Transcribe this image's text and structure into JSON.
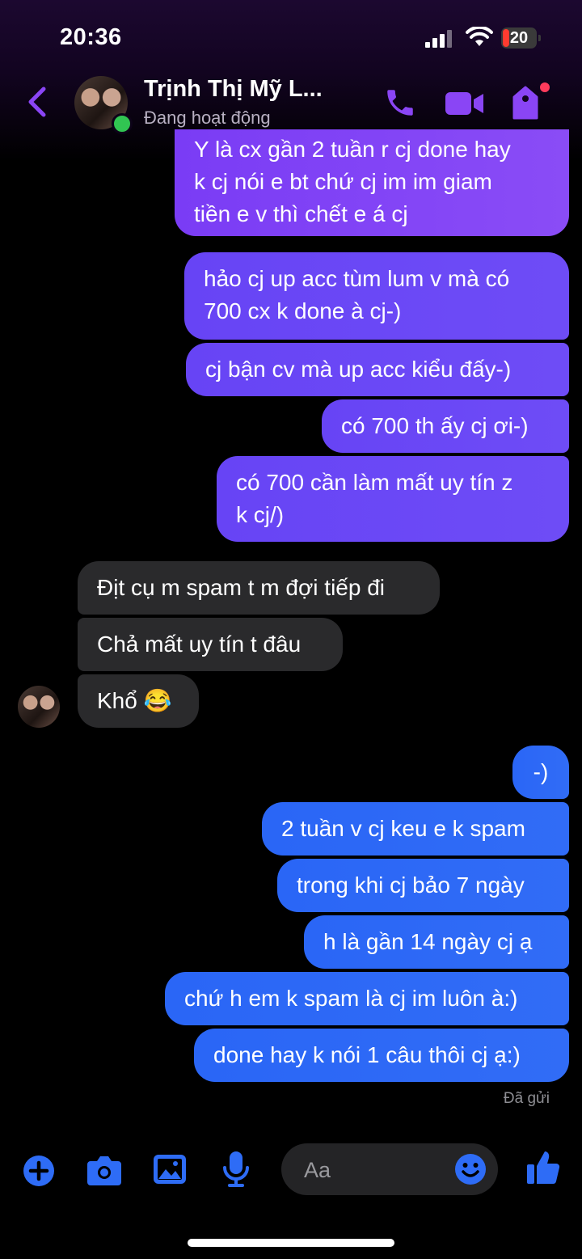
{
  "status_bar": {
    "time": "20:36",
    "battery": "20",
    "battery_level": 0.2
  },
  "header": {
    "contact_name": "Trịnh Thị Mỹ L...",
    "status": "Đang hoạt động",
    "icons": [
      "back-icon",
      "phone-icon",
      "video-icon",
      "tag-icon"
    ]
  },
  "messages": [
    {
      "side": "out",
      "lines": [
        "Y là cx gần 2 tuần r cj done hay",
        "k cj nói e bt chứ cj im im giam",
        "tiền e v thì chết e á cj"
      ]
    },
    {
      "side": "out",
      "lines": [
        "hảo cj up acc tùm lum v mà có",
        "700 cx k done à cj-)"
      ]
    },
    {
      "side": "out",
      "lines": [
        "cj bận cv mà up acc kiểu đấy-)"
      ]
    },
    {
      "side": "out",
      "lines": [
        "có 700 th ấy cj ơi-)"
      ]
    },
    {
      "side": "out",
      "lines": [
        "có 700 cần làm mất uy tín z",
        "k cj/)"
      ]
    },
    {
      "side": "in",
      "lines": [
        "Địt cụ m spam t m đợi tiếp đi"
      ]
    },
    {
      "side": "in",
      "lines": [
        "Chả mất uy tín t đâu"
      ]
    },
    {
      "side": "in",
      "lines": [
        "Khổ 😂"
      ]
    },
    {
      "side": "out",
      "lines": [
        "-)"
      ]
    },
    {
      "side": "out",
      "lines": [
        "2 tuần v cj keu e k spam"
      ]
    },
    {
      "side": "out",
      "lines": [
        "trong khi cj bảo 7 ngày"
      ]
    },
    {
      "side": "out",
      "lines": [
        "h là gần 14 ngày cj ạ"
      ]
    },
    {
      "side": "out",
      "lines": [
        "chứ h em k spam là cj im luôn à:)"
      ]
    },
    {
      "side": "out",
      "lines": [
        "done hay k nói 1 câu thôi cj ạ:)"
      ]
    }
  ],
  "seen_label": "Đã gửi",
  "composer": {
    "placeholder": "Aa",
    "icons": [
      "plus-icon",
      "camera-icon",
      "image-icon",
      "microphone-icon",
      "emoji-icon",
      "thumbs-up-icon"
    ]
  },
  "colors": {
    "accent": "#8a45f5",
    "outgoing_purple": "#7f42f5",
    "outgoing_blue": "#2e69f6",
    "incoming": "#2a2a2c",
    "online": "#31c552"
  }
}
